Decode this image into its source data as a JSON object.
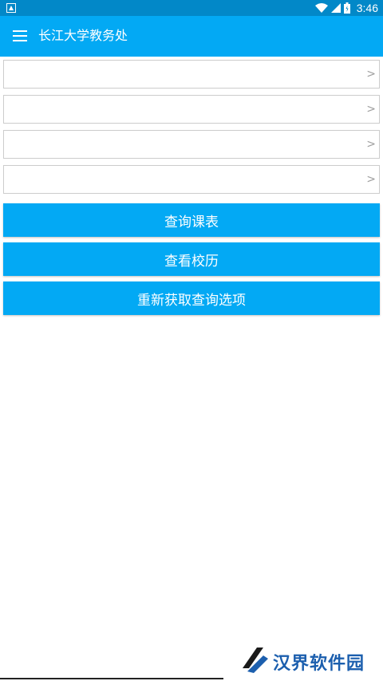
{
  "status_bar": {
    "time": "3:46",
    "icons": [
      "notification-icon",
      "wifi-icon",
      "signal-icon",
      "battery-icon"
    ]
  },
  "app_bar": {
    "title": "长江大学教务处",
    "menu_icon": "menu-icon"
  },
  "selectors": [
    {
      "value": "",
      "chevron": ">"
    },
    {
      "value": "",
      "chevron": ">"
    },
    {
      "value": "",
      "chevron": ">"
    },
    {
      "value": "",
      "chevron": ">"
    }
  ],
  "buttons": {
    "query_schedule": "查询课表",
    "view_calendar": "查看校历",
    "refresh_options": "重新获取查询选项"
  },
  "watermark": {
    "text": "汉界软件园"
  },
  "colors": {
    "status_bar": "#0288c8",
    "primary": "#03a9f4",
    "watermark": "#1c5fae"
  }
}
